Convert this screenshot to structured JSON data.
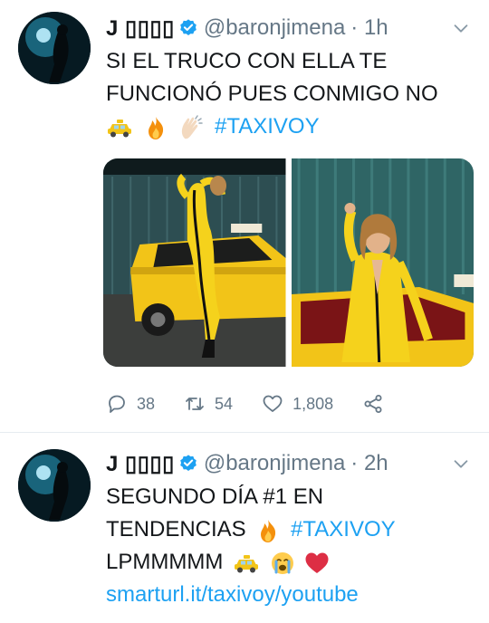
{
  "tweets": [
    {
      "name": "J 🇽🇽🇽🇽",
      "name_display": "J ▯▯▯▯",
      "handle": "@baronjimena",
      "time": "· 1h",
      "lines": [
        "SI EL TRUCO CON ELLA TE",
        "FUNCIONÓ PUES CONMIGO NO"
      ],
      "hashtag": "#TAXIVOY",
      "emojis": [
        "taxi",
        "fire",
        "clapping-hands"
      ],
      "photos": [
        "taxi-photo-left",
        "taxi-photo-right"
      ],
      "stats": {
        "replies": "38",
        "retweets": "54",
        "likes": "1,808"
      }
    },
    {
      "name_display": "J ▯▯▯▯",
      "handle": "@baronjimena",
      "time": "· 2h",
      "line1": "SEGUNDO DÍA #1 EN",
      "line2_text": "TENDENCIAS",
      "line2_hashtag": "#TAXIVOY",
      "line3_text": "LPMMMMM",
      "link": "smarturl.it/taxivoy/youtube",
      "emojis": [
        "fire",
        "taxi",
        "crying-face",
        "red-heart"
      ]
    }
  ],
  "colors": {
    "link": "#1da1f2",
    "muted": "#657786",
    "taxi_yellow": "#f2c418",
    "suit_yellow": "#f5d21c"
  }
}
